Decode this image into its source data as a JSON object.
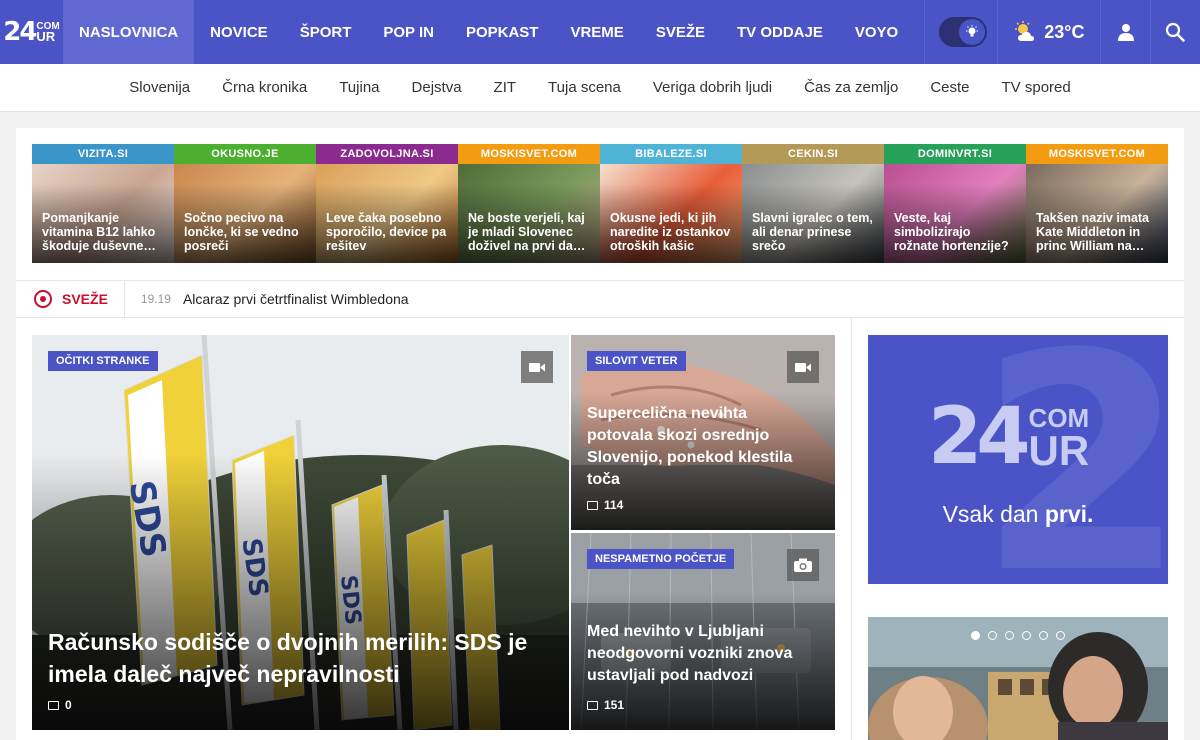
{
  "nav": {
    "logo_main": "24",
    "logo_top": "COM",
    "logo_bottom": "UR",
    "items": [
      "NASLOVNICA",
      "NOVICE",
      "ŠPORT",
      "POP IN",
      "POPKAST",
      "VREME",
      "SVEŽE",
      "TV ODDAJE",
      "VOYO"
    ],
    "active_index": 0,
    "temperature": "23°C",
    "accent": "#4a54c6"
  },
  "subnav": [
    "Slovenija",
    "Črna kronika",
    "Tujina",
    "Dejstva",
    "ZIT",
    "Tuja scena",
    "Veriga dobrih ljudi",
    "Čas za zemljo",
    "Ceste",
    "TV spored"
  ],
  "partners": [
    {
      "tag": "VIZITA.SI",
      "color": "#3a95c9",
      "title": "Pomanjkanje vitamina B12 lahko škoduje duševne…"
    },
    {
      "tag": "OKUSNO.JE",
      "color": "#4caf2f",
      "title": "Sočno pecivo na lončke, ki se vedno posreči"
    },
    {
      "tag": "ZADOVOLJNA.SI",
      "color": "#8b2a8f",
      "title": "Leve čaka posebno sporočilo, device pa rešitev"
    },
    {
      "tag": "MOSKISVET.COM",
      "color": "#f39c12",
      "title": "Ne boste verjeli, kaj je mladi Slovenec doživel na prvi da…"
    },
    {
      "tag": "BIBALEZE.SI",
      "color": "#4fb3d6",
      "title": "Okusne jedi, ki jih naredite iz ostankov otroških kašic"
    },
    {
      "tag": "CEKIN.SI",
      "color": "#b49a57",
      "title": "Slavni igralec o tem, ali denar prinese srečo"
    },
    {
      "tag": "DOMINVRT.SI",
      "color": "#27a05a",
      "title": "Veste, kaj simbolizirajo rožnate hortenzije?"
    },
    {
      "tag": "MOSKISVET.COM",
      "color": "#f39c12",
      "title": "Takšen naziv imata Kate Middleton in princ William na…"
    }
  ],
  "ticker": {
    "label": "SVEŽE",
    "time": "19.19",
    "headline": "Alcaraz prvi četrtfinalist Wimbledona"
  },
  "main_article": {
    "badge": "OČITKI STRANKE",
    "title": "Računsko sodišče o dvojnih merilih: SDS je imela daleč največ nepravilnosti",
    "comments": "0",
    "media": "video-icon",
    "flag_text": "SDS"
  },
  "side_articles": [
    {
      "badge": "SILOVIT VETER",
      "title": "Supercelična nevihta potovala skozi osrednjo Slovenijo, ponekod klestila toča",
      "comments": "114",
      "media": "video-icon"
    },
    {
      "badge": "NESPAMETNO POČETJE",
      "title": "Med nevihto v Ljubljani neodgovorni vozniki znova ustavljali pod nadvozi",
      "comments": "151",
      "media": "camera-icon"
    }
  ],
  "ad": {
    "logo_main": "24",
    "logo_top": "COM",
    "logo_bottom": "UR",
    "slogan_pre": "Vsak dan ",
    "slogan_bold": "prvi."
  },
  "promo": {
    "slides": 6,
    "active": 0
  }
}
